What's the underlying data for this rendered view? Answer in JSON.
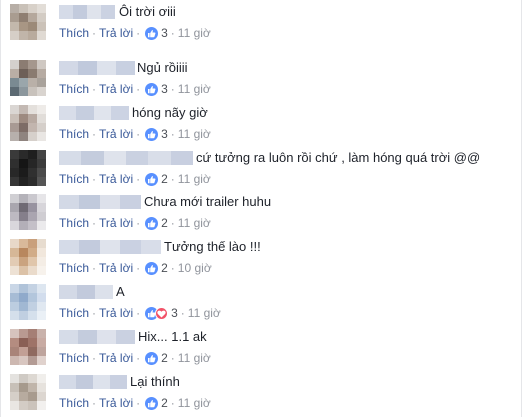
{
  "labels": {
    "like": "Thích",
    "reply": "Trả lời",
    "separator": "·"
  },
  "colors": {
    "link": "#385898",
    "meta": "#90949c",
    "like_badge": "#5890ff",
    "love_badge": "#f25268"
  },
  "comments": [
    {
      "text": "Ôi trời ơiii",
      "reactions": "3",
      "time": "11 giờ",
      "reaction_icons": [
        "like-icon"
      ]
    },
    {
      "text": "Ngủ rồiiii",
      "reactions": "3",
      "time": "11 giờ",
      "reaction_icons": [
        "like-icon"
      ]
    },
    {
      "text": "hóng nãy giờ",
      "reactions": "3",
      "time": "11 giờ",
      "reaction_icons": [
        "like-icon"
      ]
    },
    {
      "text": "cứ tưởng ra luôn rồi chứ , làm hóng quá trời @@",
      "reactions": "2",
      "time": "11 giờ",
      "reaction_icons": [
        "like-icon"
      ]
    },
    {
      "text": "Chưa mới trailer huhu",
      "reactions": "2",
      "time": "11 giờ",
      "reaction_icons": [
        "like-icon"
      ]
    },
    {
      "text": "Tưởng thế lào !!!",
      "reactions": "2",
      "time": "10 giờ",
      "reaction_icons": [
        "like-icon"
      ]
    },
    {
      "text": "A",
      "reactions": "3",
      "time": "11 giờ",
      "reaction_icons": [
        "like-icon",
        "love-icon"
      ]
    },
    {
      "text": "Hix... 1.1 ak",
      "reactions": "2",
      "time": "11 giờ",
      "reaction_icons": [
        "like-icon"
      ]
    },
    {
      "text": "Lại thính",
      "reactions": "2",
      "time": "11 giờ",
      "reaction_icons": [
        "like-icon"
      ]
    }
  ]
}
